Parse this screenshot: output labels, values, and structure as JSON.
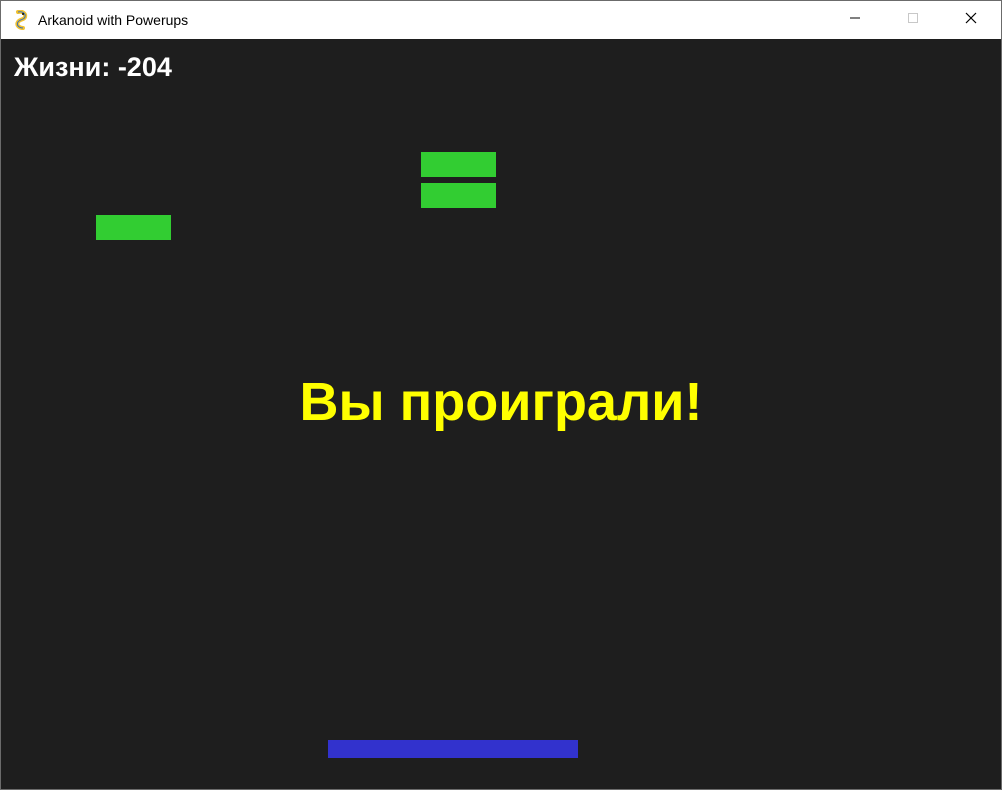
{
  "window": {
    "title": "Arkanoid with Powerups",
    "icon": "pygame-snake-icon",
    "controls": {
      "minimize_icon": "minimize-icon",
      "maximize_icon": "maximize-icon",
      "close_icon": "close-icon"
    }
  },
  "game": {
    "lives_text": "Жизни: -204",
    "lives_value": -204,
    "message": "Вы проиграли!",
    "colors": {
      "background": "#1e1e1e",
      "brick": "#32cd32",
      "paddle": "#3232cd",
      "message": "#ffff00",
      "lives_text": "#ffffff"
    },
    "bricks_remaining": 3
  }
}
